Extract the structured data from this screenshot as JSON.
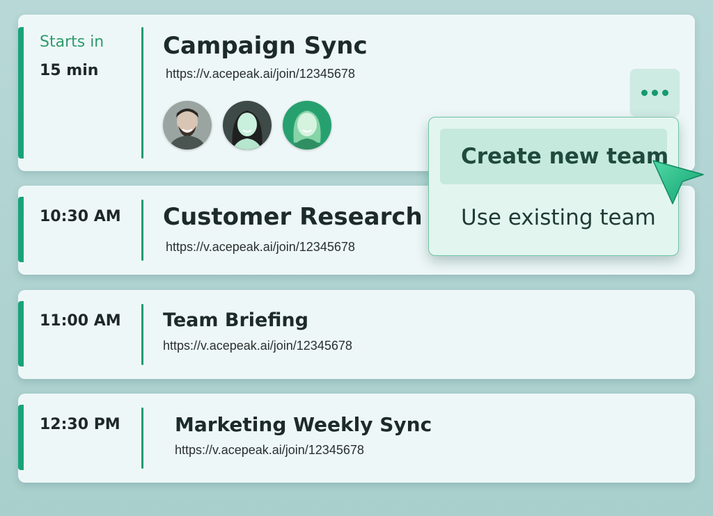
{
  "meetings": [
    {
      "time_label": "Starts in",
      "time": "15 min",
      "title": "Campaign Sync",
      "link": "https://v.acepeak.ai/join/12345678",
      "participants": [
        "participant-1",
        "participant-2",
        "participant-3"
      ]
    },
    {
      "time": "10:30 AM",
      "title": "Customer Research",
      "link": "https://v.acepeak.ai/join/12345678"
    },
    {
      "time": "11:00 AM",
      "title": "Team Briefing",
      "link": "https://v.acepeak.ai/join/12345678"
    },
    {
      "time": "12:30 PM",
      "title": "Marketing Weekly Sync",
      "link": "https://v.acepeak.ai/join/12345678"
    }
  ],
  "menu": {
    "items": [
      "Create new team",
      "Use existing team"
    ],
    "active_index": 0
  },
  "icons": {
    "more": "more-horizontal-icon",
    "cursor": "cursor-pointer-icon"
  },
  "colors": {
    "accent": "#18a37a",
    "card_bg": "#eef7f8",
    "page_bg": "#b7d8d6"
  }
}
